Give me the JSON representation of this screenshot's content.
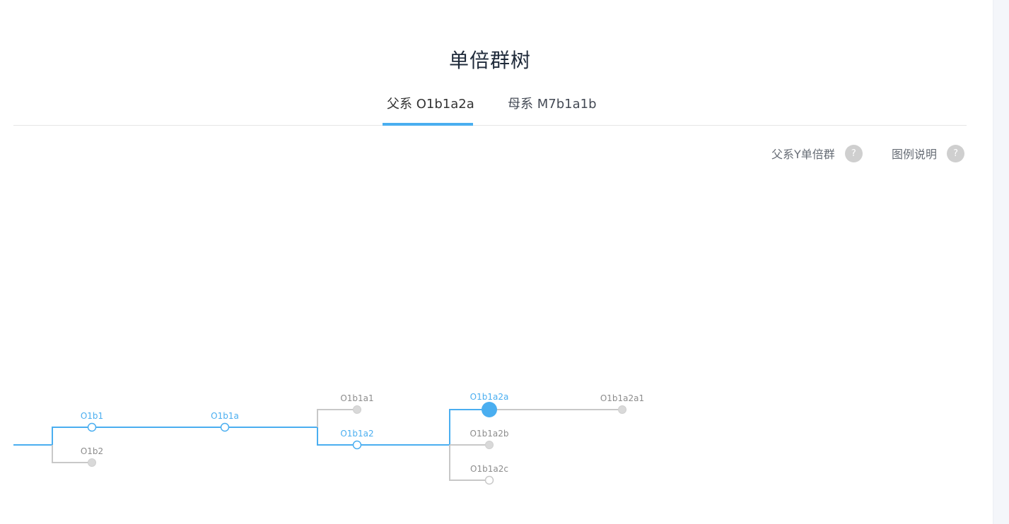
{
  "page": {
    "title": "单倍群树"
  },
  "tabs": [
    {
      "label": "父系 O1b1a2a",
      "active": true
    },
    {
      "label": "母系 M7b1a1b",
      "active": false
    }
  ],
  "tools": {
    "y_haplogroup": {
      "label": "父系Y单倍群",
      "icon": "help-icon",
      "icon_text": "?"
    },
    "legend": {
      "label": "图例说明",
      "icon": "help-icon",
      "icon_text": "?"
    }
  },
  "colors": {
    "accent": "#4aaef0",
    "inactive_line": "#c8c8c8",
    "inactive_node": "#d9d9d9",
    "inactive_text": "#8c8c8c"
  },
  "tree": {
    "nodes": [
      {
        "id": "O1b1",
        "label": "O1b1",
        "on_path": true,
        "node_style": "ring"
      },
      {
        "id": "O1b2",
        "label": "O1b2",
        "on_path": false,
        "node_style": "filled"
      },
      {
        "id": "O1b1a",
        "label": "O1b1a",
        "on_path": true,
        "node_style": "ring"
      },
      {
        "id": "O1b1a1",
        "label": "O1b1a1",
        "on_path": false,
        "node_style": "filled"
      },
      {
        "id": "O1b1a2",
        "label": "O1b1a2",
        "on_path": true,
        "node_style": "ring"
      },
      {
        "id": "O1b1a2a",
        "label": "O1b1a2a",
        "on_path": true,
        "node_style": "current"
      },
      {
        "id": "O1b1a2b",
        "label": "O1b1a2b",
        "on_path": false,
        "node_style": "filled"
      },
      {
        "id": "O1b1a2c",
        "label": "O1b1a2c",
        "on_path": false,
        "node_style": "ring"
      },
      {
        "id": "O1b1a2a1",
        "label": "O1b1a2a1",
        "on_path": false,
        "node_style": "filled"
      }
    ]
  }
}
